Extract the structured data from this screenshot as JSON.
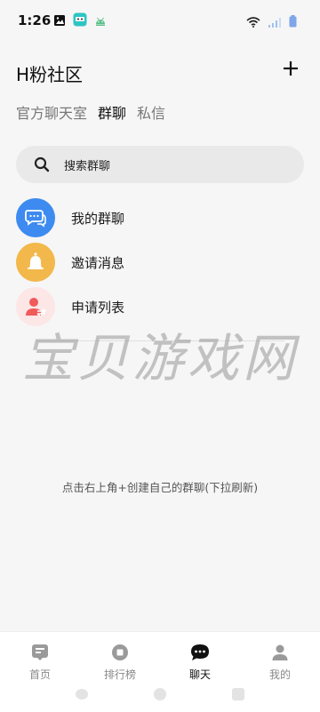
{
  "status_bar": {
    "time": "1:26",
    "icons_left": [
      "image-icon",
      "app-icon",
      "android-icon"
    ],
    "icons_right": [
      "wifi-icon",
      "signal-icon",
      "battery-icon"
    ]
  },
  "header": {
    "title": "H粉社区",
    "add_icon": "plus-icon"
  },
  "tabs": [
    {
      "label": "官方聊天室",
      "active": false
    },
    {
      "label": "群聊",
      "active": true
    },
    {
      "label": "私信",
      "active": false
    }
  ],
  "search": {
    "placeholder": "搜索群聊"
  },
  "menu": [
    {
      "label": "我的群聊",
      "icon": "chat-bubbles-icon",
      "color": "#3d8bf0"
    },
    {
      "label": "邀请消息",
      "icon": "bell-icon",
      "color": "#f2b84b"
    },
    {
      "label": "申请列表",
      "icon": "user-request-icon",
      "color": "#f15a5a"
    }
  ],
  "watermark": "宝贝游戏网",
  "empty_hint": "点击右上角+创建自己的群聊(下拉刷新)",
  "bottom_nav": [
    {
      "label": "首页",
      "icon": "home-icon",
      "active": false
    },
    {
      "label": "排行榜",
      "icon": "ranking-icon",
      "active": false
    },
    {
      "label": "聊天",
      "icon": "chat-icon",
      "active": true
    },
    {
      "label": "我的",
      "icon": "profile-icon",
      "active": false
    }
  ],
  "colors": {
    "background": "#f6f6f6",
    "search_bg": "#e9e9e9",
    "active_text": "#111111",
    "inactive_text": "#888888"
  }
}
